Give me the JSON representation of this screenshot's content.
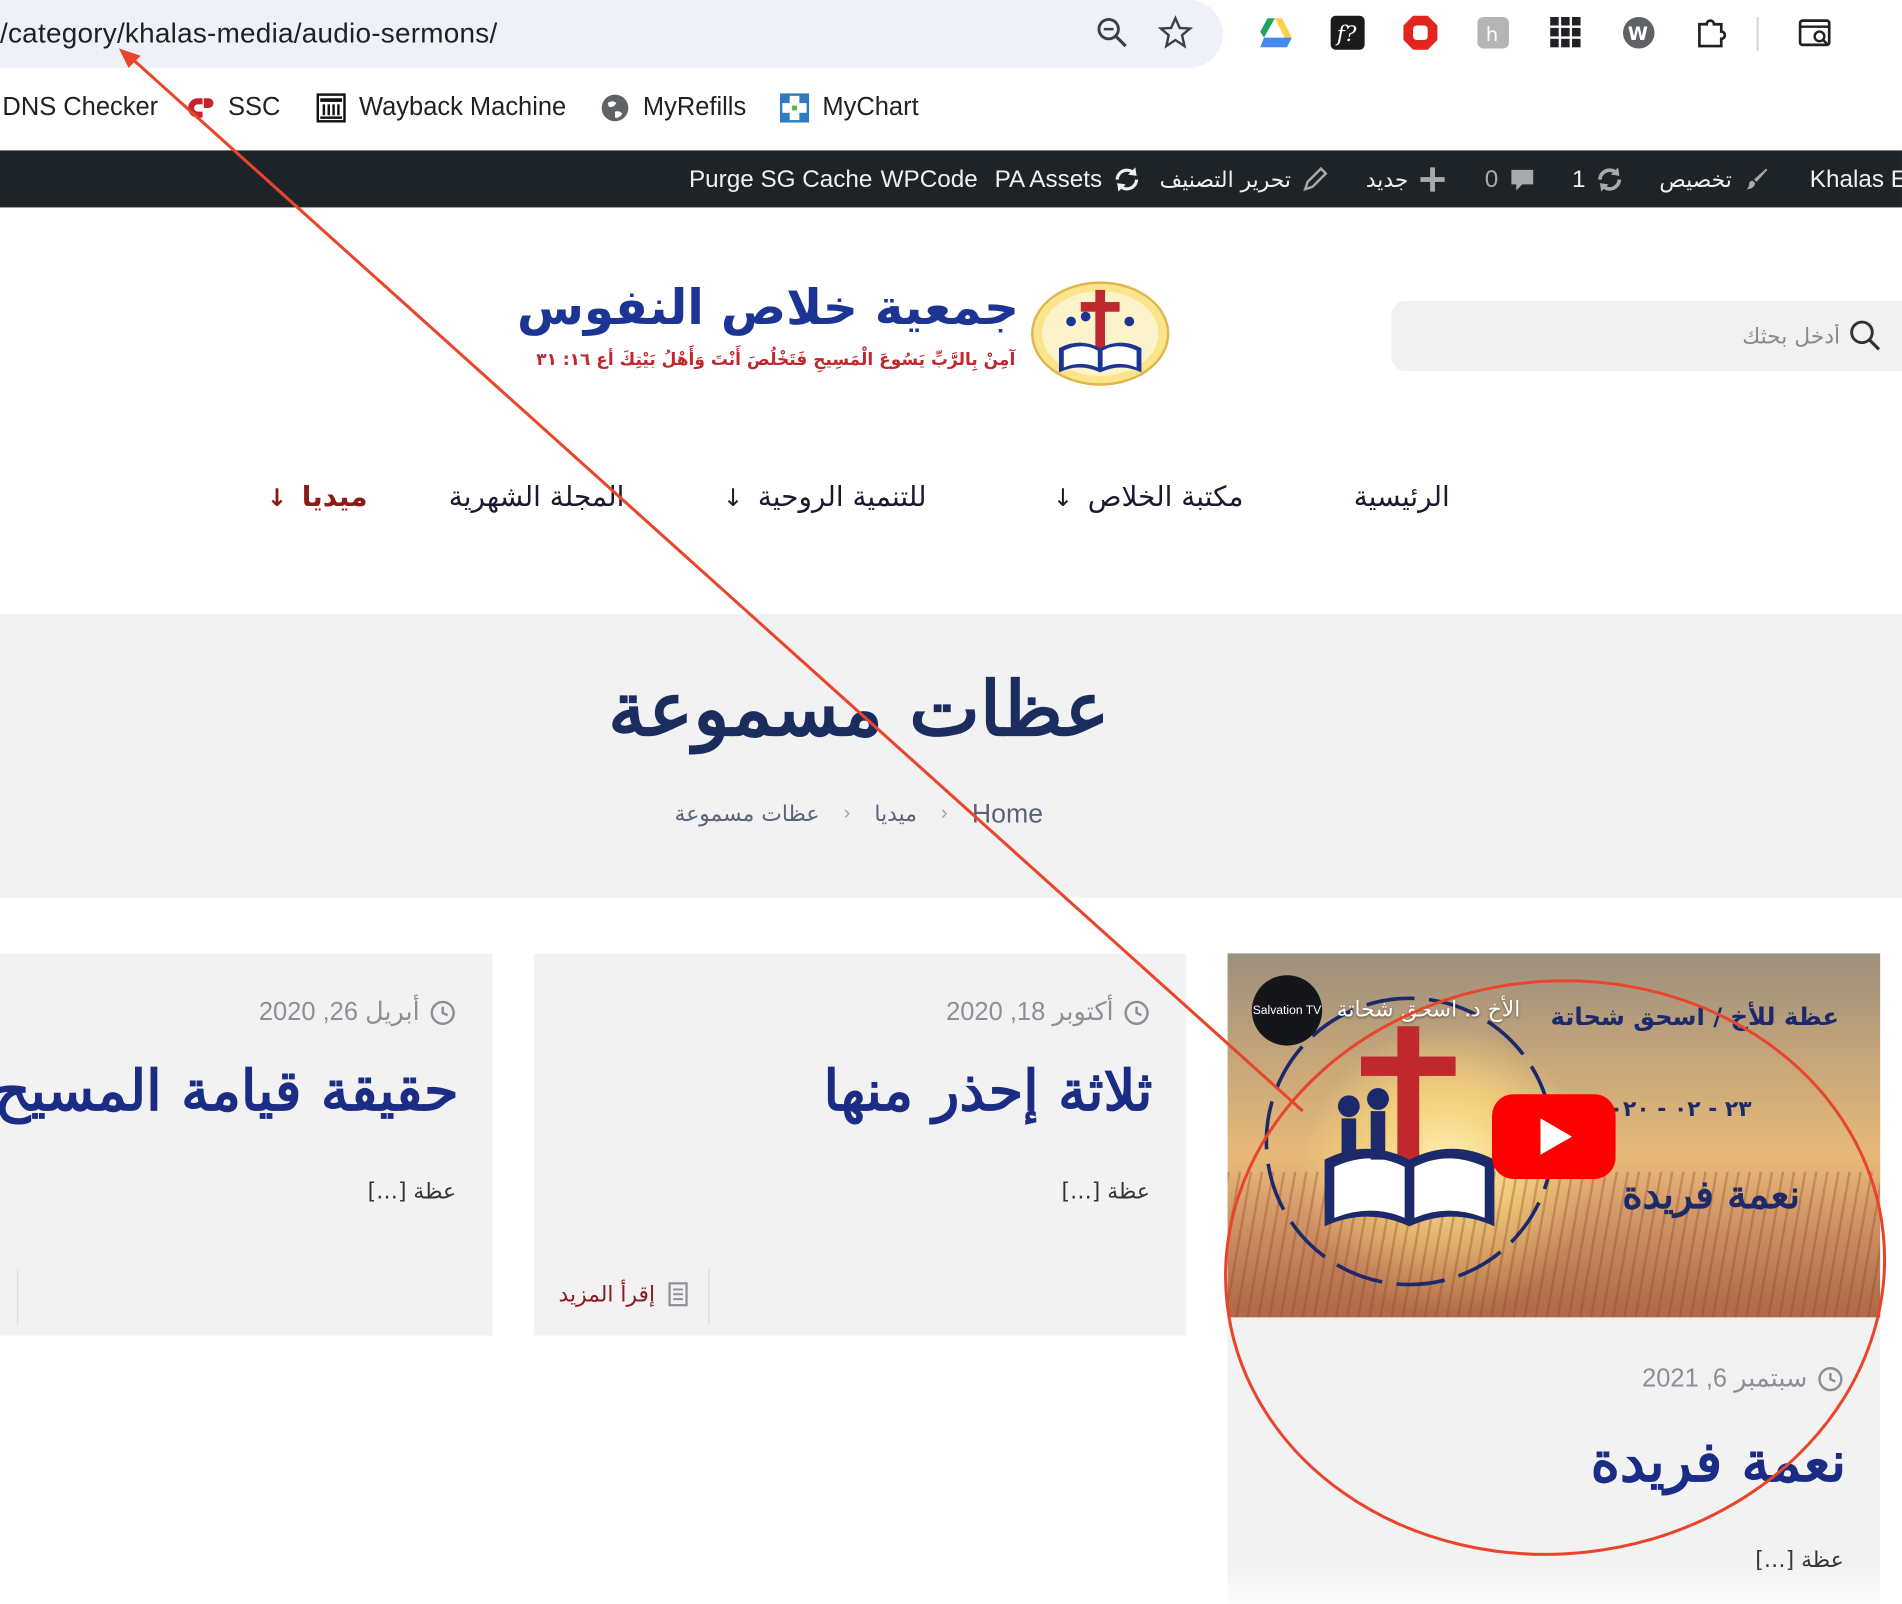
{
  "browser": {
    "url": "/category/khalas-media/audio-sermons/",
    "bookmarks": [
      {
        "label": "DNS Checker",
        "icon": "dns-checker-icon"
      },
      {
        "label": "SSC",
        "icon": "ssc-icon"
      },
      {
        "label": "Wayback Machine",
        "icon": "wayback-machine-icon"
      },
      {
        "label": "MyRefills",
        "icon": "globe-icon"
      },
      {
        "label": "MyChart",
        "icon": "mychart-icon"
      }
    ]
  },
  "adminbar": {
    "site_name": "Khalas El",
    "customize": "تخصيص",
    "updates_count": "1",
    "comments_count": "0",
    "new_label": "جديد",
    "edit_category": "تحرير التصنيف",
    "pa_assets": "PA Assets",
    "wpcode": "WPCode",
    "purge_cache": "Purge SG Cache"
  },
  "header": {
    "search_placeholder": "أدخل بحثك",
    "logo_title": "جمعية خلاص النفوس",
    "logo_subtitle": "آمِنْ بِالرَّبِّ يَسُوعَ الْمَسِيحِ فَتَخْلُصَ أَنْتَ وَأَهْلُ بَيْتِكَ أع ١٦: ٣١"
  },
  "nav": {
    "items": [
      {
        "label": "الرئيسية",
        "has_dropdown": false,
        "active": false
      },
      {
        "label": "مكتبة الخلاص",
        "has_dropdown": true,
        "active": false
      },
      {
        "label": "للتنمية الروحية",
        "has_dropdown": true,
        "active": false
      },
      {
        "label": "المجلة الشهرية",
        "has_dropdown": false,
        "active": false
      },
      {
        "label": "ميديا",
        "has_dropdown": true,
        "active": true
      }
    ],
    "arrow": "↓"
  },
  "page": {
    "title": "عظات مسموعة",
    "breadcrumb": [
      "Home",
      "ميديا",
      "عظات مسموعة"
    ],
    "breadcrumb_sep": "›"
  },
  "posts": [
    {
      "date": "سبتمبر 6, 2021",
      "title": "نعمة فريدة",
      "excerpt": "عظة […]",
      "video": {
        "channel_badge": "Salvation TV",
        "channel_name": "الأخ د. اسحق شحاتة",
        "heading": "عظة للأخ / اسحق شحاتة",
        "date": "٢٣ - ٠٢ - ٢٠٢٠",
        "big_title": "نعمة فريدة"
      }
    },
    {
      "date": "أكتوبر 18, 2020",
      "title": "ثلاثة إحذر منها",
      "excerpt": "عظة […]",
      "read_more": "إقرأ المزيد"
    },
    {
      "date": "أبريل 26, 2020",
      "title": "حقيقة قيامة المسيح",
      "excerpt": "عظة […]"
    }
  ],
  "colors": {
    "admin_bar": "#1d2327",
    "title_navy": "#1b2c5e",
    "post_title_blue": "#1b2c85",
    "active_nav": "#8b1a1a",
    "annotation_red": "#e8452c",
    "band_gray": "#f2f2f2"
  }
}
